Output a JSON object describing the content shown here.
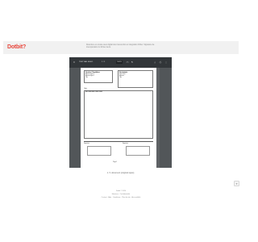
{
  "header": {
    "logo_text": "Dotbit",
    "logo_mark": "?",
    "message": "Relecture en écoute avec digital dev intervention et intégration fichier. Signature de interopération du fichier devis.",
    "brand_color": "#e8473d"
  },
  "viewer": {
    "file_title": "TEST BAL 0000.1",
    "page_indicator": "1 / 1",
    "zoom": "100%",
    "icons": [
      "menu-icon",
      "fit-page-icon",
      "rotate-icon",
      "download-icon",
      "print-icon",
      "more-icon"
    ]
  },
  "document": {
    "sender_title": "Vendeur / Expéditeur",
    "sender_lines": [
      "Adresse ligne 1",
      "Adresse ligne 2",
      "Ville"
    ],
    "recipient_title": "Destinataire",
    "recipient_lines": [
      "Nom client",
      "Adresse",
      "Ville"
    ],
    "section_label": "Objet",
    "ref_line": "Réf: 0000 0000 / 0000 / 0000",
    "sig_left_label": "Signature",
    "sig_right_label": "Signature",
    "footer_note": "Page 1"
  },
  "caption": "1 / 1 document (original signé)",
  "feedback_label": "?",
  "footer": {
    "line1": "Dotbit © 2024",
    "line2": "Mentions · Confidentialité",
    "line3": "Contact · Aide · Conditions · Plan du site · Accessibilité"
  }
}
